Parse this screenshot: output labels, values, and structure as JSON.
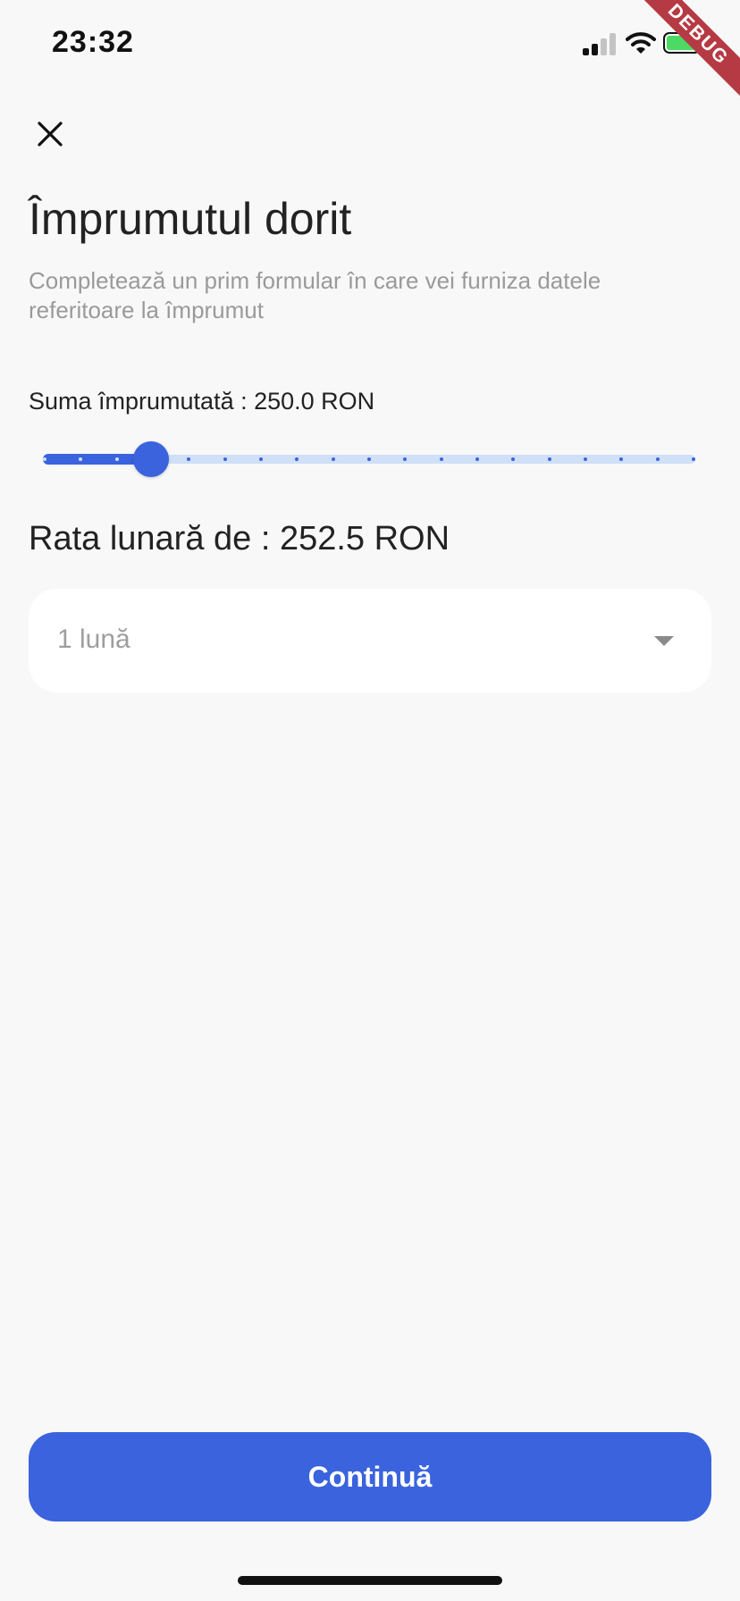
{
  "status_bar": {
    "time": "23:32",
    "signal_icon": "cellular-signal-icon",
    "wifi_icon": "wifi-icon",
    "battery_icon": "battery-icon",
    "battery_color": "#4cd964"
  },
  "debug_banner": {
    "label": "DEBUG",
    "color": "#b63a43"
  },
  "header": {
    "close_icon": "close-icon",
    "title": "Împrumutul dorit",
    "subtitle": "Completează un prim formular în care vei furniza datele referitoare la împrumut"
  },
  "loan": {
    "amount_label": "Suma împrumutată : 250.0 RON",
    "slider": {
      "fraction": 0.166,
      "tick_count": 19,
      "active_color": "#3a63dd",
      "inactive_color": "#cfe0f7"
    },
    "monthly_rate_label": "Rata lunară de : 252.5 RON"
  },
  "term_select": {
    "selected_value": "1 lună",
    "arrow_icon": "caret-down-icon"
  },
  "actions": {
    "continue_label": "Continuă",
    "accent_color": "#3a63dd"
  }
}
